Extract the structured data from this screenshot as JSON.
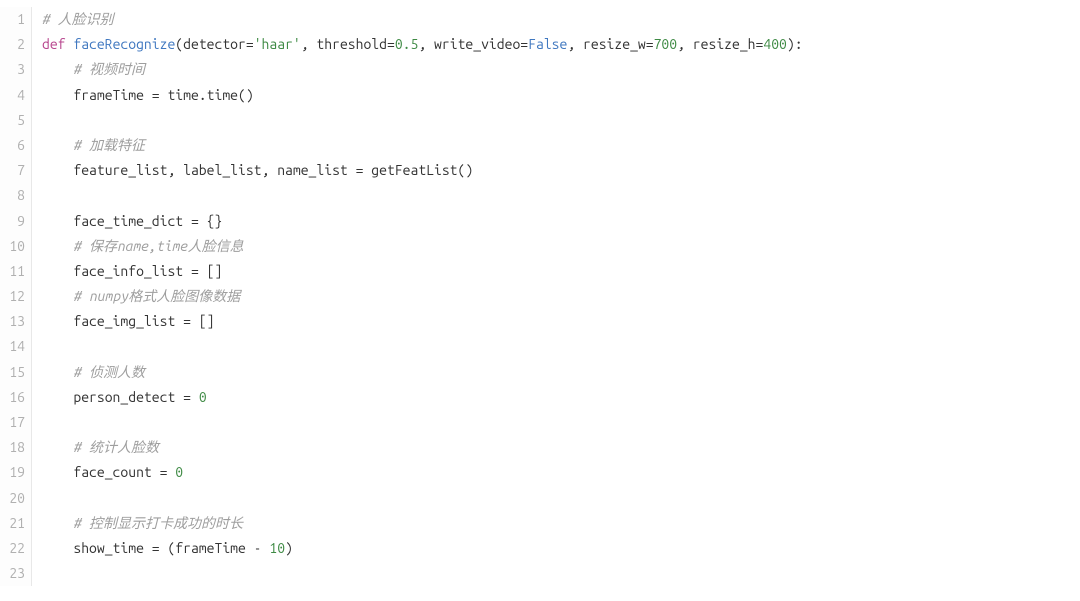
{
  "lines": [
    {
      "n": "1",
      "tokens": [
        {
          "cls": "tok-comment",
          "text": "# 人脸识别"
        }
      ]
    },
    {
      "n": "2",
      "tokens": [
        {
          "cls": "tok-keyword",
          "text": "def"
        },
        {
          "cls": "tok-default",
          "text": " "
        },
        {
          "cls": "tok-funcname",
          "text": "faceRecognize"
        },
        {
          "cls": "tok-default",
          "text": "(detector="
        },
        {
          "cls": "tok-string",
          "text": "'haar'"
        },
        {
          "cls": "tok-default",
          "text": ", threshold="
        },
        {
          "cls": "tok-number",
          "text": "0.5"
        },
        {
          "cls": "tok-default",
          "text": ", write_video="
        },
        {
          "cls": "tok-builtin",
          "text": "False"
        },
        {
          "cls": "tok-default",
          "text": ", resize_w="
        },
        {
          "cls": "tok-number",
          "text": "700"
        },
        {
          "cls": "tok-default",
          "text": ", resize_h="
        },
        {
          "cls": "tok-number",
          "text": "400"
        },
        {
          "cls": "tok-default",
          "text": "):"
        }
      ]
    },
    {
      "n": "3",
      "tokens": [
        {
          "cls": "tok-default",
          "text": "    "
        },
        {
          "cls": "tok-comment",
          "text": "# 视频时间"
        }
      ]
    },
    {
      "n": "4",
      "tokens": [
        {
          "cls": "tok-default",
          "text": "    frameTime = time.time()"
        }
      ]
    },
    {
      "n": "5",
      "tokens": []
    },
    {
      "n": "6",
      "tokens": [
        {
          "cls": "tok-default",
          "text": "    "
        },
        {
          "cls": "tok-comment",
          "text": "# 加载特征"
        }
      ]
    },
    {
      "n": "7",
      "tokens": [
        {
          "cls": "tok-default",
          "text": "    feature_list, label_list, name_list = getFeatList()"
        }
      ]
    },
    {
      "n": "8",
      "tokens": []
    },
    {
      "n": "9",
      "tokens": [
        {
          "cls": "tok-default",
          "text": "    face_time_dict = {}"
        }
      ]
    },
    {
      "n": "10",
      "tokens": [
        {
          "cls": "tok-default",
          "text": "    "
        },
        {
          "cls": "tok-comment",
          "text": "# 保存name,time人脸信息"
        }
      ]
    },
    {
      "n": "11",
      "tokens": [
        {
          "cls": "tok-default",
          "text": "    face_info_list = []"
        }
      ]
    },
    {
      "n": "12",
      "tokens": [
        {
          "cls": "tok-default",
          "text": "    "
        },
        {
          "cls": "tok-comment",
          "text": "# numpy格式人脸图像数据"
        }
      ]
    },
    {
      "n": "13",
      "tokens": [
        {
          "cls": "tok-default",
          "text": "    face_img_list = []"
        }
      ]
    },
    {
      "n": "14",
      "tokens": []
    },
    {
      "n": "15",
      "tokens": [
        {
          "cls": "tok-default",
          "text": "    "
        },
        {
          "cls": "tok-comment",
          "text": "# 侦测人数"
        }
      ]
    },
    {
      "n": "16",
      "tokens": [
        {
          "cls": "tok-default",
          "text": "    person_detect = "
        },
        {
          "cls": "tok-number",
          "text": "0"
        }
      ]
    },
    {
      "n": "17",
      "tokens": []
    },
    {
      "n": "18",
      "tokens": [
        {
          "cls": "tok-default",
          "text": "    "
        },
        {
          "cls": "tok-comment",
          "text": "# 统计人脸数"
        }
      ]
    },
    {
      "n": "19",
      "tokens": [
        {
          "cls": "tok-default",
          "text": "    face_count = "
        },
        {
          "cls": "tok-number",
          "text": "0"
        }
      ]
    },
    {
      "n": "20",
      "tokens": []
    },
    {
      "n": "21",
      "tokens": [
        {
          "cls": "tok-default",
          "text": "    "
        },
        {
          "cls": "tok-comment",
          "text": "# 控制显示打卡成功的时长"
        }
      ]
    },
    {
      "n": "22",
      "tokens": [
        {
          "cls": "tok-default",
          "text": "    show_time = (frameTime - "
        },
        {
          "cls": "tok-number",
          "text": "10"
        },
        {
          "cls": "tok-default",
          "text": ")"
        }
      ]
    },
    {
      "n": "23",
      "tokens": []
    }
  ]
}
